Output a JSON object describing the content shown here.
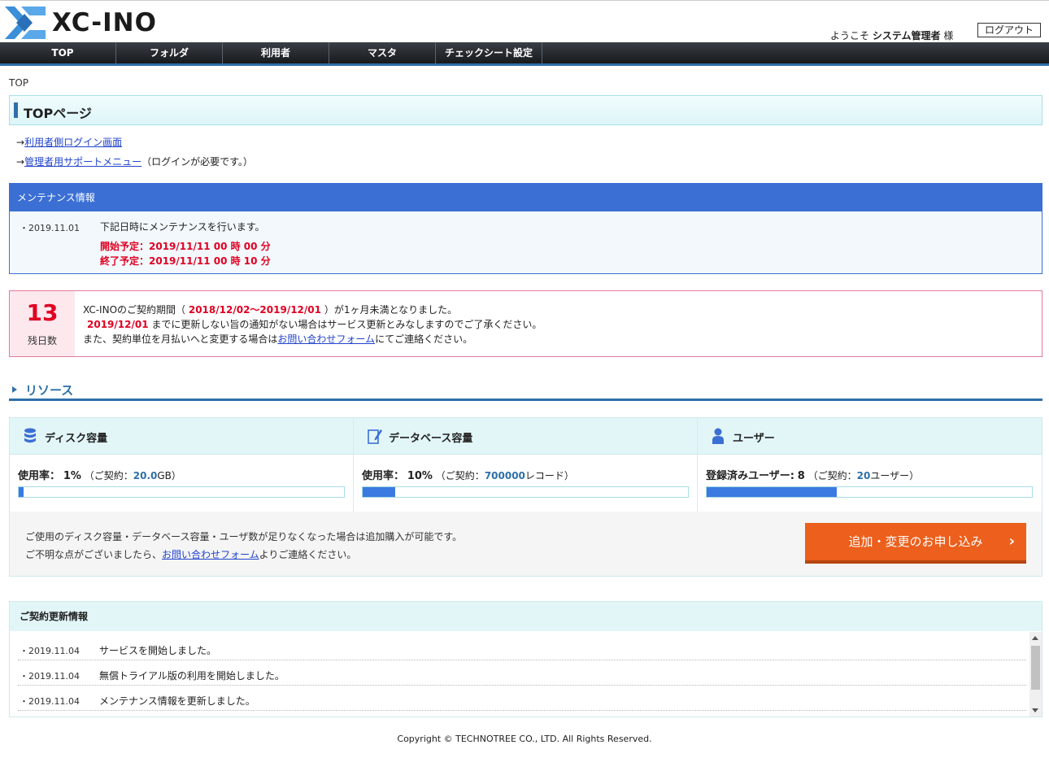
{
  "header": {
    "logo_text": "XC-INO",
    "welcome_prefix": "ようこそ",
    "user_name": "システム管理者",
    "welcome_suffix": "様",
    "logout_label": "ログアウト"
  },
  "nav": {
    "items": [
      {
        "label": "TOP"
      },
      {
        "label": "フォルダ"
      },
      {
        "label": "利用者"
      },
      {
        "label": "マスタ"
      },
      {
        "label": "チェックシート設定"
      }
    ]
  },
  "breadcrumb": "TOP",
  "page_title": "TOPページ",
  "links": {
    "arrow": "→",
    "user_login": "利用者側ログイン画面",
    "admin_support": "管理者用サポートメニュー",
    "admin_support_note": "（ログインが必要です。）"
  },
  "maintenance": {
    "heading": "メンテナンス情報",
    "date": "・2019.11.01",
    "text": "下記日時にメンテナンスを行います。",
    "start": "開始予定：2019/11/11 00 時 00 分",
    "end": "終了予定：2019/11/11 00 時 10 分"
  },
  "contract": {
    "days_remaining": "13",
    "days_label": "残日数",
    "line1_prefix": "XC-INOのご契約期間（",
    "period": "2018/12/02～2019/12/01",
    "line1_suffix": "）が1ヶ月未満となりました。",
    "line2_date": "2019/12/01",
    "line2_text": "までに更新しない旨の通知がない場合はサービス更新とみなしますのでご了承ください。",
    "line3_prefix": "また、契約単位を月払いへと変更する場合は",
    "line3_link": "お問い合わせフォーム",
    "line3_suffix": "にてご連絡ください。"
  },
  "resources": {
    "heading": "リソース",
    "disk": {
      "title": "ディスク容量",
      "usage_label": "使用率：",
      "usage_value": "1%",
      "contract_prefix": "（ご契約：",
      "contract_value": "20.0",
      "contract_suffix": "GB）",
      "fill_percent": 1
    },
    "database": {
      "title": "データベース容量",
      "usage_label": "使用率：",
      "usage_value": "10%",
      "contract_prefix": "（ご契約：",
      "contract_value": "700000",
      "contract_suffix": "レコード）",
      "fill_percent": 10
    },
    "users": {
      "title": "ユーザー",
      "usage_label": "登録済みユーザー:",
      "usage_value": "8",
      "contract_prefix": "（ご契約：",
      "contract_value": "20",
      "contract_suffix": "ユーザー）",
      "fill_percent": 40
    },
    "info_line1": "ご使用のディスク容量・データベース容量・ユーザ数が足りなくなった場合は追加購入が可能です。",
    "info_line2_prefix": "ご不明な点がございましたら、",
    "info_line2_link": "お問い合わせフォーム",
    "info_line2_suffix": "よりご連絡ください。",
    "apply_button": "追加・変更のお申し込み",
    "apply_chevron": "›"
  },
  "updates": {
    "heading": "ご契約更新情報",
    "rows": [
      {
        "date": "・2019.11.04",
        "text": "サービスを開始しました。"
      },
      {
        "date": "・2019.11.04",
        "text": "無償トライアル版の利用を開始しました。"
      },
      {
        "date": "・2019.11.04",
        "text": "メンテナンス情報を更新しました。"
      }
    ]
  },
  "footer": "Copyright © TECHNOTREE CO., LTD. All Rights Reserved.",
  "colors": {
    "brand_blue": "#2f6fa8",
    "accent_red": "#e00022",
    "button_orange": "#ec5f1c",
    "progress_blue": "#3b7ae0"
  }
}
